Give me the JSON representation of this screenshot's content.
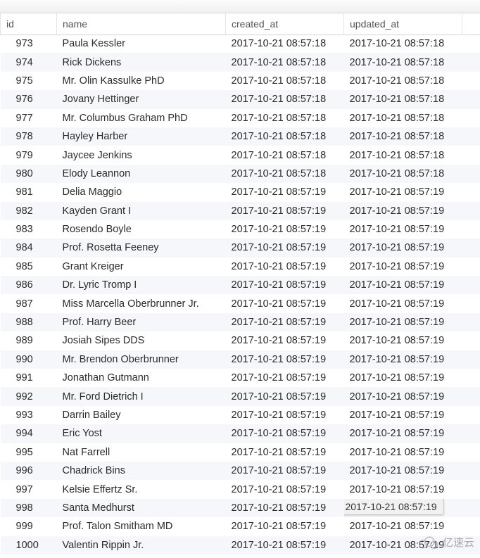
{
  "headers": {
    "id": "id",
    "name": "name",
    "created_at": "created_at",
    "updated_at": "updated_at"
  },
  "tooltip": "2017-10-21 08:57:19",
  "watermark": "亿速云",
  "rows": [
    {
      "id": "973",
      "name": "Paula Kessler",
      "ca": "2017-10-21 08:57:18",
      "ua": "2017-10-21 08:57:18"
    },
    {
      "id": "974",
      "name": "Rick Dickens",
      "ca": "2017-10-21 08:57:18",
      "ua": "2017-10-21 08:57:18"
    },
    {
      "id": "975",
      "name": "Mr. Olin Kassulke PhD",
      "ca": "2017-10-21 08:57:18",
      "ua": "2017-10-21 08:57:18"
    },
    {
      "id": "976",
      "name": "Jovany Hettinger",
      "ca": "2017-10-21 08:57:18",
      "ua": "2017-10-21 08:57:18"
    },
    {
      "id": "977",
      "name": "Mr. Columbus Graham PhD",
      "ca": "2017-10-21 08:57:18",
      "ua": "2017-10-21 08:57:18"
    },
    {
      "id": "978",
      "name": "Hayley Harber",
      "ca": "2017-10-21 08:57:18",
      "ua": "2017-10-21 08:57:18"
    },
    {
      "id": "979",
      "name": "Jaycee Jenkins",
      "ca": "2017-10-21 08:57:18",
      "ua": "2017-10-21 08:57:18"
    },
    {
      "id": "980",
      "name": "Elody Leannon",
      "ca": "2017-10-21 08:57:18",
      "ua": "2017-10-21 08:57:18"
    },
    {
      "id": "981",
      "name": "Delia Maggio",
      "ca": "2017-10-21 08:57:19",
      "ua": "2017-10-21 08:57:19"
    },
    {
      "id": "982",
      "name": "Kayden Grant I",
      "ca": "2017-10-21 08:57:19",
      "ua": "2017-10-21 08:57:19"
    },
    {
      "id": "983",
      "name": "Rosendo Boyle",
      "ca": "2017-10-21 08:57:19",
      "ua": "2017-10-21 08:57:19"
    },
    {
      "id": "984",
      "name": "Prof. Rosetta Feeney",
      "ca": "2017-10-21 08:57:19",
      "ua": "2017-10-21 08:57:19"
    },
    {
      "id": "985",
      "name": "Grant Kreiger",
      "ca": "2017-10-21 08:57:19",
      "ua": "2017-10-21 08:57:19"
    },
    {
      "id": "986",
      "name": "Dr. Lyric Tromp I",
      "ca": "2017-10-21 08:57:19",
      "ua": "2017-10-21 08:57:19"
    },
    {
      "id": "987",
      "name": "Miss Marcella Oberbrunner Jr.",
      "ca": "2017-10-21 08:57:19",
      "ua": "2017-10-21 08:57:19"
    },
    {
      "id": "988",
      "name": "Prof. Harry Beer",
      "ca": "2017-10-21 08:57:19",
      "ua": "2017-10-21 08:57:19"
    },
    {
      "id": "989",
      "name": "Josiah Sipes DDS",
      "ca": "2017-10-21 08:57:19",
      "ua": "2017-10-21 08:57:19"
    },
    {
      "id": "990",
      "name": "Mr. Brendon Oberbrunner",
      "ca": "2017-10-21 08:57:19",
      "ua": "2017-10-21 08:57:19"
    },
    {
      "id": "991",
      "name": "Jonathan Gutmann",
      "ca": "2017-10-21 08:57:19",
      "ua": "2017-10-21 08:57:19"
    },
    {
      "id": "992",
      "name": "Mr. Ford Dietrich I",
      "ca": "2017-10-21 08:57:19",
      "ua": "2017-10-21 08:57:19"
    },
    {
      "id": "993",
      "name": "Darrin Bailey",
      "ca": "2017-10-21 08:57:19",
      "ua": "2017-10-21 08:57:19"
    },
    {
      "id": "994",
      "name": "Eric Yost",
      "ca": "2017-10-21 08:57:19",
      "ua": "2017-10-21 08:57:19"
    },
    {
      "id": "995",
      "name": "Nat Farrell",
      "ca": "2017-10-21 08:57:19",
      "ua": "2017-10-21 08:57:19"
    },
    {
      "id": "996",
      "name": "Chadrick Bins",
      "ca": "2017-10-21 08:57:19",
      "ua": "2017-10-21 08:57:19"
    },
    {
      "id": "997",
      "name": "Kelsie Effertz Sr.",
      "ca": "2017-10-21 08:57:19",
      "ua": "2017-10-21 08:57:19"
    },
    {
      "id": "998",
      "name": "Santa Medhurst",
      "ca": "2017-10-21 08:57:19",
      "ua": "2017-10-21 08:57:19",
      "tooltip": true
    },
    {
      "id": "999",
      "name": "Prof. Talon Smitham MD",
      "ca": "2017-10-21 08:57:19",
      "ua": "2017-10-21 08:57:19"
    },
    {
      "id": "1000",
      "name": "Valentin Rippin Jr.",
      "ca": "2017-10-21 08:57:19",
      "ua": "2017-10-21 08:57:19"
    }
  ]
}
